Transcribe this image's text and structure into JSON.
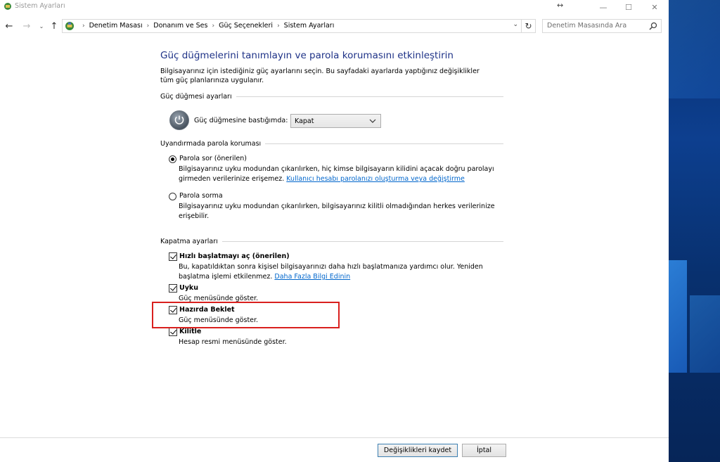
{
  "window": {
    "title": "Sistem Ayarları",
    "resize_glyph": "↔",
    "controls": {
      "minimize": "—",
      "maximize": "☐",
      "close": "✕"
    }
  },
  "nav": {
    "back": "←",
    "forward": "→",
    "dropdown": "⌄",
    "up": "↑",
    "breadcrumbs": [
      "Denetim Masası",
      "Donanım ve Ses",
      "Güç Seçenekleri",
      "Sistem Ayarları"
    ],
    "breadcrumb_sep": "›",
    "address_dropdown": "⌄",
    "refresh": "↻",
    "search_placeholder": "Denetim Masasında Ara"
  },
  "page": {
    "title": "Güç düğmelerini tanımlayın ve parola korumasını etkinleştirin",
    "description": "Bilgisayarınız için istediğiniz güç ayarlarını seçin. Bu sayfadaki ayarlarda yaptığınız değişiklikler tüm güç planlarınıza uygulanır."
  },
  "power_button_section": {
    "header": "Güç düğmesi ayarları",
    "label": "Güç düğmesine bastığımda:",
    "selected": "Kapat"
  },
  "wake_password_section": {
    "header": "Uyandırmada parola koruması",
    "options": [
      {
        "label": "Parola sor (önerilen)",
        "selected": true,
        "description": "Bilgisayarınız uyku modundan çıkarılırken, hiç kimse bilgisayarın kilidini açacak doğru parolayı girmeden verilerinize erişemez.",
        "link": "Kullanıcı hesabı parolanızı oluşturma veya değiştirme"
      },
      {
        "label": "Parola sorma",
        "selected": false,
        "description": "Bilgisayarınız uyku modundan çıkarılırken, bilgisayarınız kilitli olmadığından herkes verilerinize erişebilir."
      }
    ]
  },
  "shutdown_section": {
    "header": "Kapatma ayarları",
    "options": [
      {
        "label": "Hızlı başlatmayı aç (önerilen)",
        "checked": true,
        "description": "Bu, kapatıldıktan sonra kişisel bilgisayarınızı daha hızlı başlatmanıza yardımcı olur. Yeniden başlatma işlemi etkilenmez.",
        "link": "Daha Fazla Bilgi Edinin"
      },
      {
        "label": "Uyku",
        "checked": true,
        "description": "Güç menüsünde göster."
      },
      {
        "label": "Hazırda Beklet",
        "checked": true,
        "description": "Güç menüsünde göster."
      },
      {
        "label": "Kilitle",
        "checked": true,
        "description": "Hesap resmi menüsünde göster."
      }
    ]
  },
  "buttons": {
    "save": "Değişiklikleri kaydet",
    "cancel": "İptal"
  },
  "colors": {
    "title_blue": "#1e3287",
    "link_blue": "#0066cc",
    "highlight_red": "#d9201e"
  }
}
